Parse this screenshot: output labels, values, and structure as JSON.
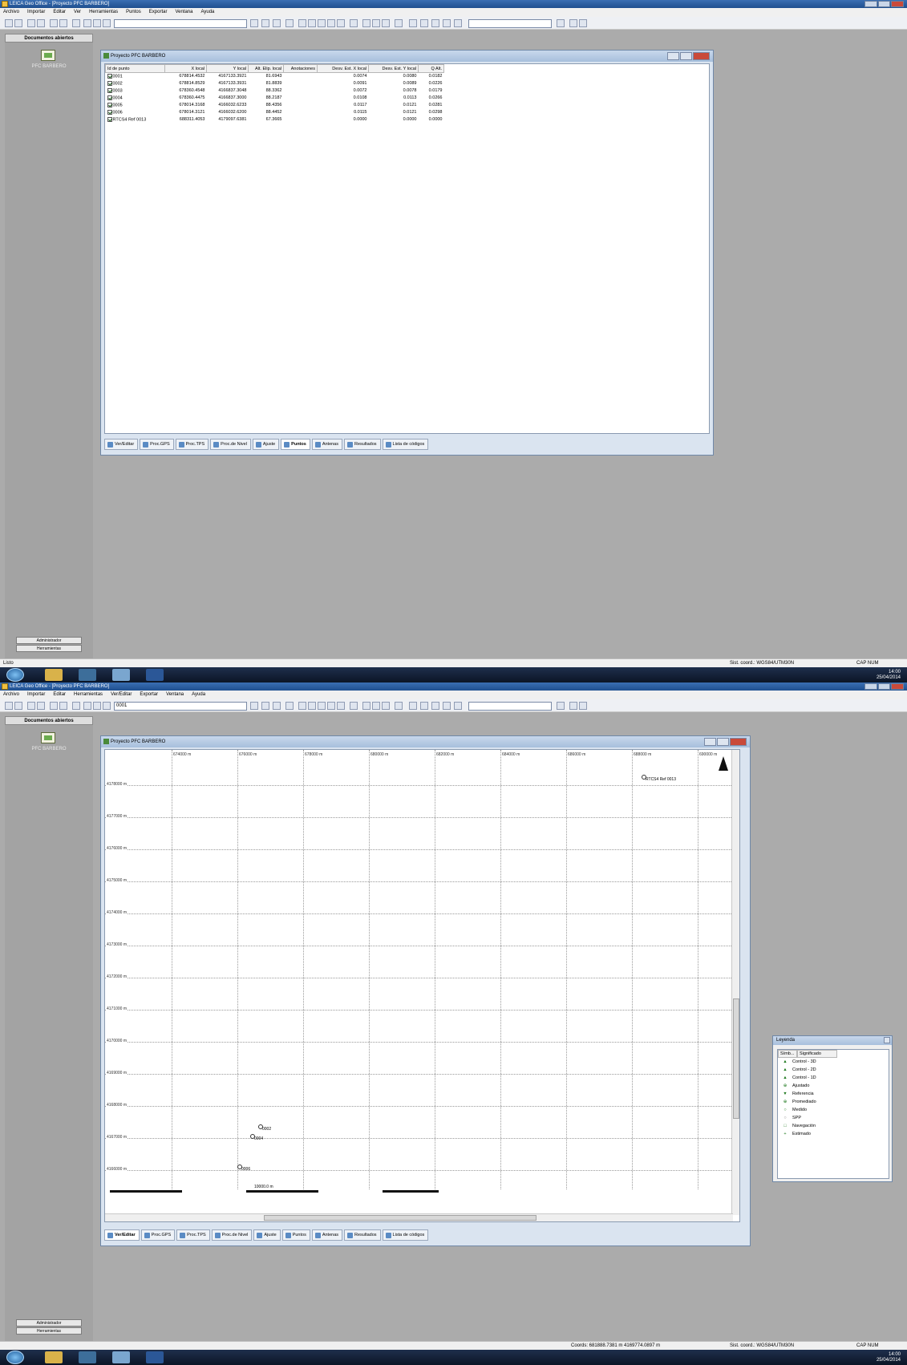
{
  "app": {
    "title": "LEICA Geo Office - [Proyecto PFC BARBERO]",
    "menu": [
      "Archivo",
      "Importar",
      "Editar",
      "Ver",
      "Herramientas",
      "Puntos",
      "Exportar",
      "Ventana",
      "Ayuda"
    ],
    "menu2": [
      "Archivo",
      "Importar",
      "Editar",
      "Herramientas",
      "Ver/Editar",
      "Exportar",
      "Ventana",
      "Ayuda"
    ],
    "toolbar_combo2": "0001"
  },
  "sidebar": {
    "header": "Documentos abiertos",
    "project_label": "PFC BARBERO",
    "btn_admin": "Administrador",
    "btn_tools": "Herramientas"
  },
  "statusbar": {
    "ready": "Listo",
    "sys_coord": "Sist. coord.: WGS84/UTM30N",
    "cap": "CAP NUM",
    "coords": "Coords: 681888.7381 m  4169774.0897 m"
  },
  "taskbar": {
    "time": "14:00",
    "date": "25/04/2014"
  },
  "window1": {
    "title": "Proyecto PFC BARBERO",
    "columns": [
      "Id de punto",
      "X local",
      "Y local",
      "Alt. Elip. local",
      "Anotaciones",
      "Desv. Est. X local",
      "Desv. Est. Y local",
      "Q Alt."
    ],
    "rows": [
      [
        "0001",
        "678814.4532",
        "4167133.3921",
        "81.6943",
        "",
        "0.0074",
        "0.0080",
        "0.0182"
      ],
      [
        "0002",
        "678814.8529",
        "4167133.3931",
        "81.8839",
        "",
        "0.0091",
        "0.0089",
        "0.0226"
      ],
      [
        "0003",
        "678360.4548",
        "4166837.3048",
        "88.3362",
        "",
        "0.0072",
        "0.0078",
        "0.0179"
      ],
      [
        "0004",
        "678360.4475",
        "4166837.3000",
        "88.2187",
        "",
        "0.0108",
        "0.0113",
        "0.0266"
      ],
      [
        "0005",
        "678014.3168",
        "4166032.6233",
        "88.4356",
        "",
        "0.0117",
        "0.0121",
        "0.0281"
      ],
      [
        "0006",
        "678014.3121",
        "4166032.6200",
        "88.4452",
        "",
        "0.0115",
        "0.0121",
        "0.0298"
      ],
      [
        "RTCS4 Ref 0013",
        "688311.4053",
        "4179097.6381",
        "67.3665",
        "",
        "0.0000",
        "0.0000",
        "0.0000"
      ]
    ],
    "tabs": [
      "Ver/Editar",
      "Proc.GPS",
      "Proc.TPS",
      "Proc.de Nivel",
      "Ajuste",
      "Puntos",
      "Antenas",
      "Resultados",
      "Lista de códigos"
    ],
    "active_tab": "Puntos"
  },
  "window2": {
    "title": "Proyecto PFC BARBERO",
    "x_ticks": [
      "674000 m",
      "676000 m",
      "678000 m",
      "680000 m",
      "682000 m",
      "684000 m",
      "686000 m",
      "688000 m",
      "690000 m"
    ],
    "y_ticks": [
      "4178000 m",
      "4177000 m",
      "4176000 m",
      "4175000 m",
      "4174000 m",
      "4173000 m",
      "4172000 m",
      "4171000 m",
      "4170000 m",
      "4169000 m",
      "4168000 m",
      "4167000 m",
      "4166000 m"
    ],
    "points": [
      "RTCS4 Ref 0013",
      "0002",
      "0004",
      "0006"
    ],
    "scale_label": "10000.0 m",
    "tabs": [
      "Ver/Editar",
      "Proc.GPS",
      "Proc.TPS",
      "Proc.de Nivel",
      "Ajuste",
      "Puntos",
      "Antenas",
      "Resultados",
      "Lista de códigos"
    ],
    "active_tab": "Ver/Editar"
  },
  "legend": {
    "title": "Leyenda",
    "col_symbol": "Símb...",
    "col_meaning": "Significado",
    "items": [
      {
        "sym": "▲",
        "label": "Control - 3D",
        "color": "#1f7a1f"
      },
      {
        "sym": "▲",
        "label": "Control - 2D",
        "color": "#1f7a1f"
      },
      {
        "sym": "▲",
        "label": "Control - 1D",
        "color": "#1f7a1f"
      },
      {
        "sym": "⊕",
        "label": "Ajustado",
        "color": "#1f7a1f"
      },
      {
        "sym": "▼",
        "label": "Referencia",
        "color": "#1f7a1f"
      },
      {
        "sym": "⊕",
        "label": "Promediado",
        "color": "#1f7a1f"
      },
      {
        "sym": "○",
        "label": "Medido",
        "color": "#1f7a1f"
      },
      {
        "sym": "○",
        "label": "SPP",
        "color": "#888888"
      },
      {
        "sym": "□",
        "label": "Navegación",
        "color": "#1f7a1f"
      },
      {
        "sym": "+",
        "label": "Estimado",
        "color": "#1f7a1f"
      }
    ]
  }
}
